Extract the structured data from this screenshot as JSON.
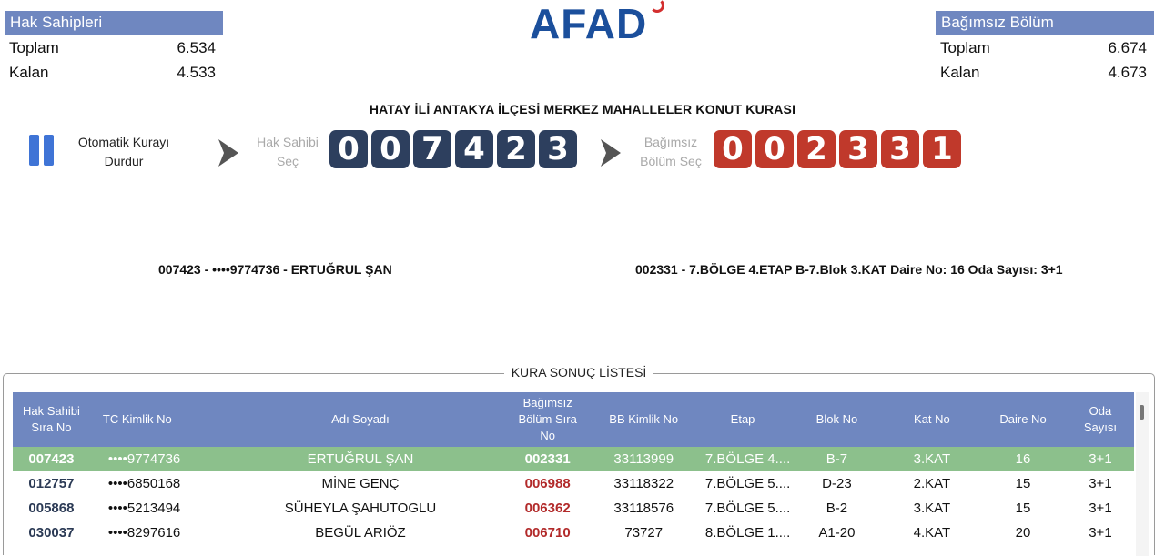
{
  "hak_sahipleri": {
    "title": "Hak Sahipleri",
    "rows": [
      {
        "label": "Toplam",
        "value": "6.534"
      },
      {
        "label": "Kalan",
        "value": "4.533"
      }
    ]
  },
  "bagimsiz_bolum": {
    "title": "Bağımsız Bölüm",
    "rows": [
      {
        "label": "Toplam",
        "value": "6.674"
      },
      {
        "label": "Kalan",
        "value": "4.673"
      }
    ]
  },
  "logo": {
    "text": "AFAD"
  },
  "title": "HATAY İLİ ANTAKYA İLÇESİ MERKEZ MAHALLELER KONUT KURASI",
  "controls": {
    "auto_line1": "Otomatik Kurayı",
    "auto_line2": "Durdur",
    "hak_sahibi_line1": "Hak Sahibi",
    "hak_sahibi_line2": "Seç",
    "bb_line1": "Bağımsız",
    "bb_line2": "Bölüm Seç",
    "hak_digits": [
      "0",
      "0",
      "7",
      "4",
      "2",
      "3"
    ],
    "bb_digits": [
      "0",
      "0",
      "2",
      "3",
      "3",
      "1"
    ]
  },
  "selection": {
    "person": "007423 - ••••9774736 - ERTUĞRUL ŞAN",
    "unit": "002331 - 7.BÖLGE 4.ETAP B-7.Blok 3.KAT Daire No: 16 Oda Sayısı: 3+1"
  },
  "results": {
    "legend": "KURA SONUÇ LİSTESİ",
    "headers": {
      "sira_l1": "Hak Sahibi",
      "sira_l2": "Sıra No",
      "tc": "TC Kimlik No",
      "ad": "Adı Soyadı",
      "bb_l1": "Bağımsız",
      "bb_l2": "Bölüm Sıra",
      "bb_l3": "No",
      "bbk": "BB Kimlik No",
      "etap": "Etap",
      "blok": "Blok No",
      "kat": "Kat No",
      "daire": "Daire No",
      "oda_l1": "Oda",
      "oda_l2": "Sayısı"
    },
    "rows": [
      {
        "sira": "007423",
        "tc": "••••9774736",
        "ad": "ERTUĞRUL ŞAN",
        "bb": "002331",
        "bbk": "33113999",
        "etap": "7.BÖLGE 4....",
        "blok": "B-7",
        "kat": "3.KAT",
        "daire": "16",
        "oda": "3+1"
      },
      {
        "sira": "012757",
        "tc": "••••6850168",
        "ad": "MİNE GENÇ",
        "bb": "006988",
        "bbk": "33118322",
        "etap": "7.BÖLGE 5....",
        "blok": "D-23",
        "kat": "2.KAT",
        "daire": "15",
        "oda": "3+1"
      },
      {
        "sira": "005868",
        "tc": "••••5213494",
        "ad": "SÜHEYLA ŞAHUTOGLU",
        "bb": "006362",
        "bbk": "33118576",
        "etap": "7.BÖLGE 5....",
        "blok": "B-2",
        "kat": "3.KAT",
        "daire": "15",
        "oda": "3+1"
      },
      {
        "sira": "030037",
        "tc": "••••8297616",
        "ad": "BEGÜL ARIÖZ",
        "bb": "006710",
        "bbk": "73727",
        "etap": "8.BÖLGE 1....",
        "blok": "A1-20",
        "kat": "4.KAT",
        "daire": "20",
        "oda": "3+1"
      }
    ]
  }
}
